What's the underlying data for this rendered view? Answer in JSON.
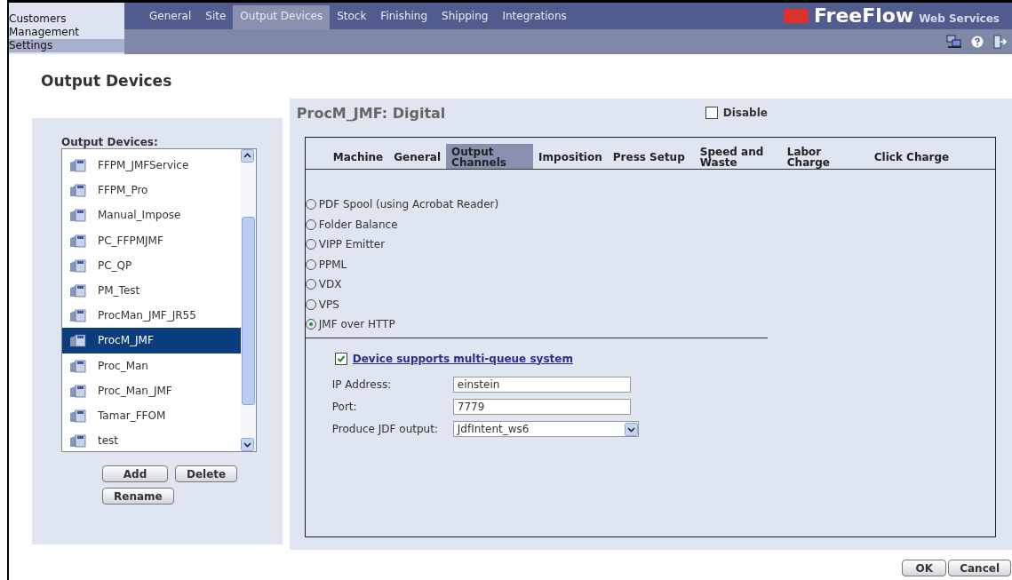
{
  "nav": [
    {
      "label": "Customers",
      "selected": false
    },
    {
      "label": "Management",
      "selected": false
    },
    {
      "label": "Settings",
      "selected": true
    }
  ],
  "top_tabs": [
    {
      "label": "General",
      "selected": false
    },
    {
      "label": "Site",
      "selected": false
    },
    {
      "label": "Output Devices",
      "selected": true
    },
    {
      "label": "Stock",
      "selected": false
    },
    {
      "label": "Finishing",
      "selected": false
    },
    {
      "label": "Shipping",
      "selected": false
    },
    {
      "label": "Integrations",
      "selected": false
    }
  ],
  "logo": {
    "name": "FreeFlow",
    "subtitle": "Web Services"
  },
  "page_title": "Output Devices",
  "device_list": {
    "label": "Output Devices:",
    "items": [
      {
        "name": "FFPM_JMFService",
        "selected": false
      },
      {
        "name": "FFPM_Pro",
        "selected": false
      },
      {
        "name": "Manual_Impose",
        "selected": false
      },
      {
        "name": "PC_FFPMJMF",
        "selected": false
      },
      {
        "name": "PC_QP",
        "selected": false
      },
      {
        "name": "PM_Test",
        "selected": false
      },
      {
        "name": "ProcMan_JMF_JR55",
        "selected": false
      },
      {
        "name": "ProcM_JMF",
        "selected": true
      },
      {
        "name": "Proc_Man",
        "selected": false
      },
      {
        "name": "Proc_Man_JMF",
        "selected": false
      },
      {
        "name": "Tamar_FFOM",
        "selected": false
      },
      {
        "name": "test",
        "selected": false
      }
    ],
    "buttons": [
      "Add",
      "Delete",
      "Rename"
    ]
  },
  "detail": {
    "title": "ProcM_JMF: Digital",
    "disable": {
      "label": "Disable",
      "checked": false
    },
    "tabs": [
      {
        "label": "Machine",
        "selected": false
      },
      {
        "label": "General",
        "selected": false
      },
      {
        "label": "Output Channels",
        "selected": true
      },
      {
        "label": "Imposition",
        "selected": false
      },
      {
        "label": "Press Setup",
        "selected": false
      },
      {
        "label": "Speed and Waste",
        "selected": false
      },
      {
        "label": "Labor Charge",
        "selected": false
      },
      {
        "label": "Click Charge",
        "selected": false
      }
    ],
    "channels": [
      {
        "label": "PDF Spool (using Acrobat Reader)",
        "selected": false
      },
      {
        "label": "Folder Balance",
        "selected": false
      },
      {
        "label": "VIPP Emitter",
        "selected": false
      },
      {
        "label": "PPML",
        "selected": false
      },
      {
        "label": "VDX",
        "selected": false
      },
      {
        "label": "VPS",
        "selected": false
      },
      {
        "label": "JMF over HTTP",
        "selected": true
      }
    ],
    "multi_queue": {
      "label": "Device supports multi-queue system",
      "checked": true
    },
    "fields": [
      {
        "label": "IP Address:",
        "value": "einstein",
        "kind": "text"
      },
      {
        "label": "Port:",
        "value": "7779",
        "kind": "text"
      },
      {
        "label": "Produce JDF output:",
        "value": "JdfIntent_ws6",
        "kind": "select"
      }
    ]
  },
  "footer_buttons": [
    "OK",
    "Cancel"
  ]
}
